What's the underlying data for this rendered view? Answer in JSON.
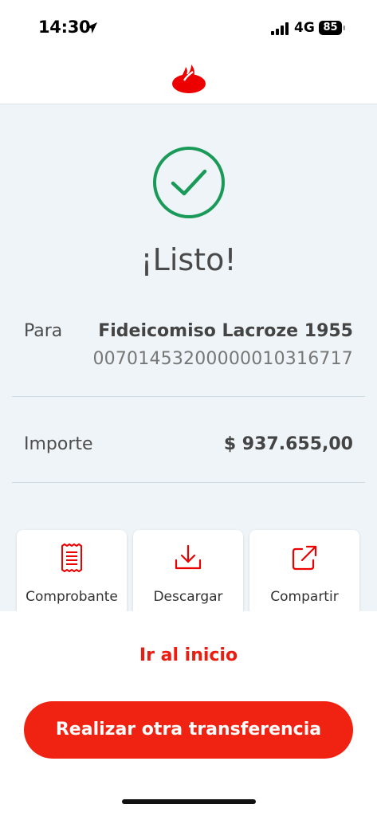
{
  "status_bar": {
    "time": "14:30",
    "network": "4G",
    "battery": "85"
  },
  "brand": {
    "logo_icon": "santander-flame-icon",
    "color": "#ec0000"
  },
  "success": {
    "icon": "check-circle-icon",
    "icon_color": "#1a9a58",
    "title": "¡Listo!"
  },
  "recipient": {
    "label": "Para",
    "name": "Fideicomiso Lacroze 1955",
    "account": "00701453200000010316717"
  },
  "amount": {
    "label": "Importe",
    "value": "$ 937.655,00"
  },
  "actions": [
    {
      "label": "Comprobante",
      "icon": "receipt-icon"
    },
    {
      "label": "Descargar",
      "icon": "download-icon"
    },
    {
      "label": "Compartir",
      "icon": "share-icon"
    }
  ],
  "footer": {
    "home_link": "Ir al inicio",
    "primary_button": "Realizar otra transferencia",
    "accent_color": "#f02211"
  }
}
